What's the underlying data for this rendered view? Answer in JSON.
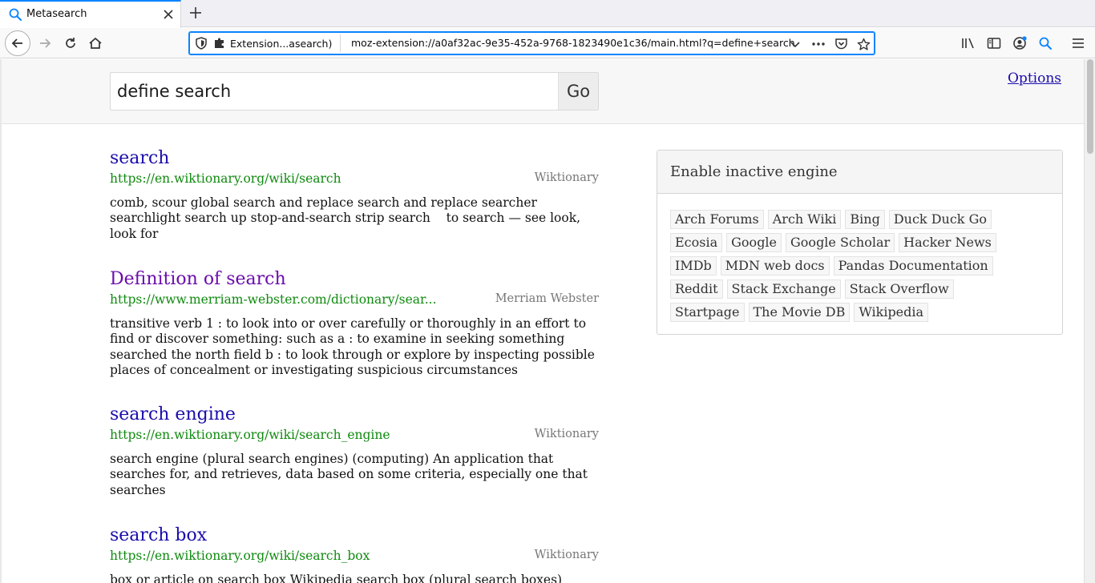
{
  "browser": {
    "tab": {
      "title": "Metasearch"
    },
    "urlbar": {
      "extension_label": "Extension...asearch)",
      "url": "moz-extension://a0af32ac-9e35-452a-9768-1823490e1c36/main.html?q=define+search"
    },
    "accent": "#0a84ff"
  },
  "search": {
    "query": "define search",
    "go_label": "Go"
  },
  "options_label": "Options",
  "results": [
    {
      "title": "search",
      "url": "https://en.wiktionary.org/wiki/search",
      "source": "Wiktionary",
      "snippet": "comb, scour global search and replace search and replace searcher searchlight search up stop-and-search strip search    to search — see look, look for"
    },
    {
      "title": "Definition of search",
      "url": "https://www.merriam-webster.com/dictionary/sear...",
      "source": "Merriam Webster",
      "snippet": "transitive verb 1 : to look into or over carefully or thoroughly in an effort to find or discover something: such as a : to examine in seeking something searched the north field b : to look through or explore by inspecting possible places of concealment or investigating suspicious circumstances"
    },
    {
      "title": "search engine",
      "url": "https://en.wiktionary.org/wiki/search_engine",
      "source": "Wiktionary",
      "snippet": "search engine (plural search engines) (computing) An application that searches for, and retrieves, data based on some criteria, especially one that searches"
    },
    {
      "title": "search box",
      "url": "https://en.wiktionary.org/wiki/search_box",
      "source": "Wiktionary",
      "snippet": "box or article on search box Wikipedia search box (plural search boxes)"
    }
  ],
  "engine_panel": {
    "title": "Enable inactive engine",
    "engines": [
      "Arch Forums",
      "Arch Wiki",
      "Bing",
      "Duck Duck Go",
      "Ecosia",
      "Google",
      "Google Scholar",
      "Hacker News",
      "IMDb",
      "MDN web docs",
      "Pandas Documentation",
      "Reddit",
      "Stack Exchange",
      "Stack Overflow",
      "Startpage",
      "The Movie DB",
      "Wikipedia"
    ]
  }
}
